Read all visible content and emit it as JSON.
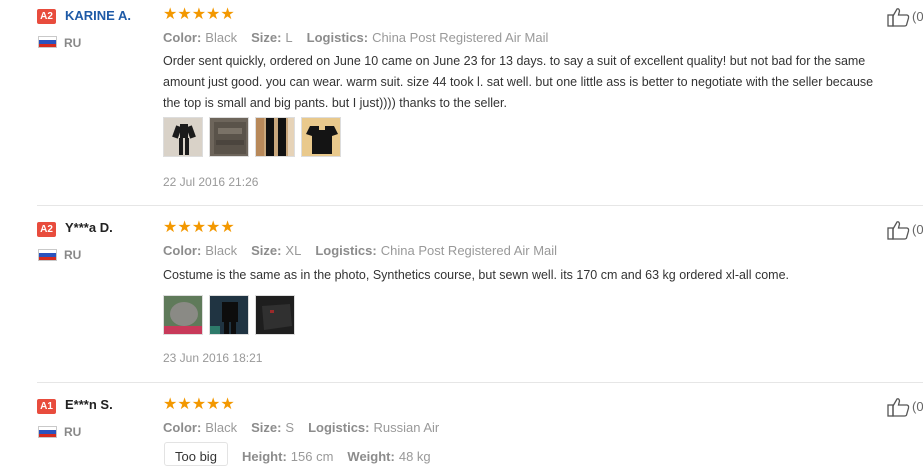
{
  "reviews": [
    {
      "badge": "A2",
      "badge_color": "#e84c3d",
      "name": "KARINE A.",
      "name_color": "#1e5aa7",
      "country": "RU",
      "stars": "★★★★★",
      "rating": 5,
      "vote_count": "(0",
      "color_label": "Color:",
      "color_value": "Black",
      "size_label": "Size:",
      "size_value": "L",
      "logistics_label": "Logistics:",
      "logistics_value": "China Post Registered Air Mail",
      "text_lines": [
        "Order sent quickly, ordered on June 10 came on June 23 for 13 days. to say a suit of excellent quality! but not bad for the same",
        "amount just good. you can wear. warm suit. size 44 took l. sat well. but one little ass is better to negotiate with the seller because",
        "the top is small and big pants. but I just)))) thanks to the seller."
      ],
      "date": "22 Jul 2016 21:26"
    },
    {
      "badge": "A2",
      "badge_color": "#e84c3d",
      "name": "Y***a D.",
      "name_color": "#222222",
      "country": "RU",
      "stars": "★★★★★",
      "rating": 5,
      "vote_count": "(0",
      "color_label": "Color:",
      "color_value": "Black",
      "size_label": "Size:",
      "size_value": "XL",
      "logistics_label": "Logistics:",
      "logistics_value": "China Post Registered Air Mail",
      "text_lines": [
        "Costume is the same as in the photo, Synthetics course, but sewn well. its 170 cm and 63 kg ordered xl-all come."
      ],
      "date": "23 Jun 2016 18:21"
    },
    {
      "badge": "A1",
      "badge_color": "#e84c3d",
      "name": "E***n S.",
      "name_color": "#222222",
      "country": "RU",
      "stars": "★★★★★",
      "rating": 5,
      "vote_count": "(0",
      "color_label": "Color:",
      "color_value": "Black",
      "size_label": "Size:",
      "size_value": "S",
      "logistics_label": "Logistics:",
      "logistics_value": "Russian Air",
      "fit_label": "Too big",
      "height_label": "Height:",
      "height_value": "156 cm",
      "weight_label": "Weight:",
      "weight_value": "48 kg"
    }
  ],
  "colors": {
    "star": "#f39800",
    "divider": "#e6e6e6",
    "muted": "#999999"
  }
}
